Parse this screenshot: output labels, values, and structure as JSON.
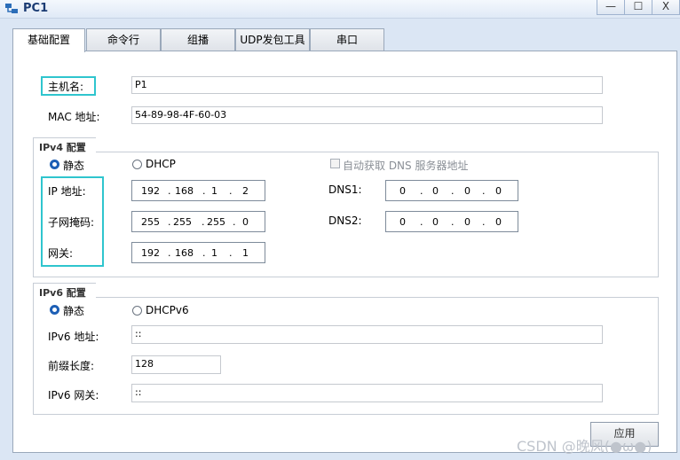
{
  "window": {
    "title": "PC1",
    "minimize": "—",
    "maximize": "☐",
    "close": "X"
  },
  "tabs": [
    {
      "label": "基础配置",
      "active": true
    },
    {
      "label": "命令行"
    },
    {
      "label": "组播"
    },
    {
      "label": "UDP发包工具"
    },
    {
      "label": "串口"
    }
  ],
  "basic": {
    "hostname_label": "主机名:",
    "hostname_value": "P1",
    "mac_label": "MAC 地址:",
    "mac_value": "54-89-98-4F-60-03"
  },
  "ipv4": {
    "title": "IPv4 配置",
    "static_label": "静态",
    "dhcp_label": "DHCP",
    "auto_dns_label": "自动获取 DNS 服务器地址",
    "ip_label": "IP 地址:",
    "ip": [
      "192",
      "168",
      "1",
      "2"
    ],
    "mask_label": "子网掩码:",
    "mask": [
      "255",
      "255",
      "255",
      "0"
    ],
    "gateway_label": "网关:",
    "gateway": [
      "192",
      "168",
      "1",
      "1"
    ],
    "dns1_label": "DNS1:",
    "dns1": [
      "0",
      "0",
      "0",
      "0"
    ],
    "dns2_label": "DNS2:",
    "dns2": [
      "0",
      "0",
      "0",
      "0"
    ]
  },
  "ipv6": {
    "title": "IPv6 配置",
    "static_label": "静态",
    "dhcp_label": "DHCPv6",
    "ip_label": "IPv6 地址:",
    "ip_value": "::",
    "prefix_label": "前缀长度:",
    "prefix_value": "128",
    "gateway_label": "IPv6 网关:",
    "gateway_value": "::"
  },
  "apply_button": "应用",
  "watermark": "CSDN @晚风(●ω●)",
  "colors": {
    "highlight": "#2fc5ce",
    "radio_selected": "#1d5fb5",
    "title_text": "#1a3b73"
  }
}
